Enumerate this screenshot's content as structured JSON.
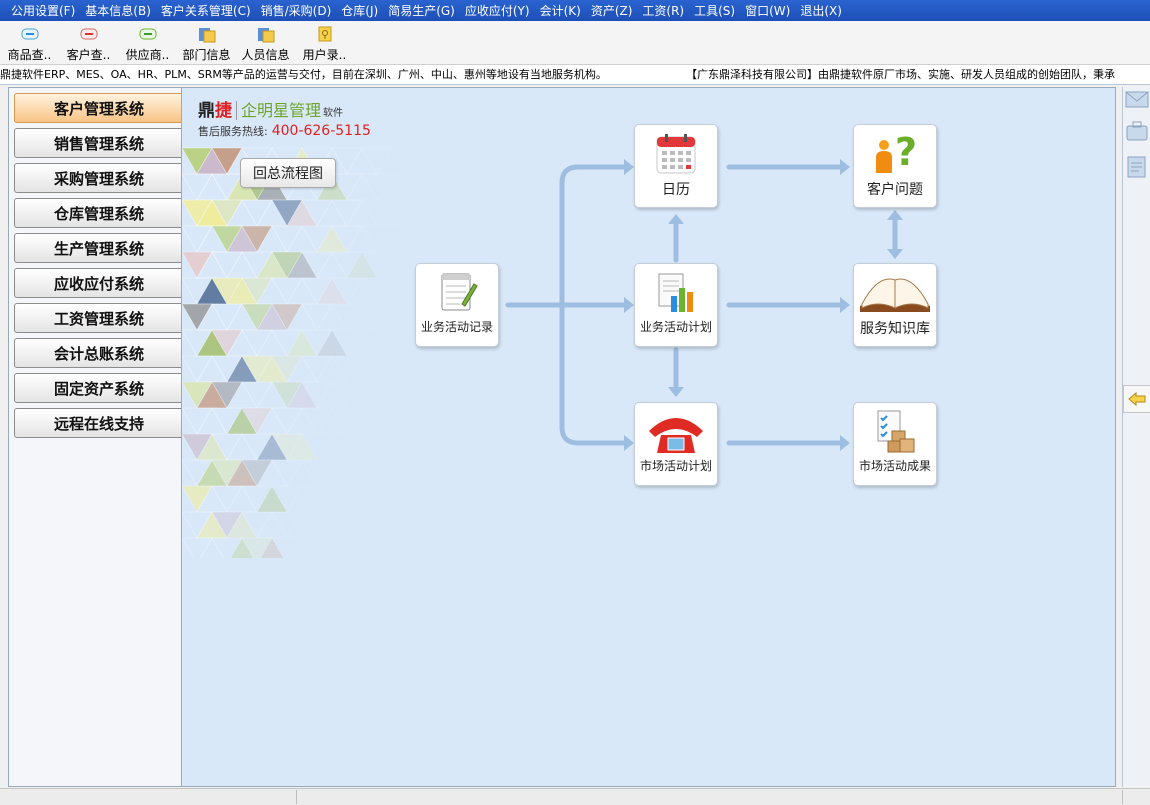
{
  "menu": [
    "公用设置(F)",
    "基本信息(B)",
    "客户关系管理(C)",
    "销售/采购(D)",
    "仓库(J)",
    "简易生产(G)",
    "应收应付(Y)",
    "会计(K)",
    "资产(Z)",
    "工资(R)",
    "工具(S)",
    "窗口(W)",
    "退出(X)"
  ],
  "toolbar": [
    {
      "label": "商品查..",
      "icon": "product-query-icon"
    },
    {
      "label": "客户查..",
      "icon": "customer-query-icon"
    },
    {
      "label": "供应商..",
      "icon": "supplier-icon"
    },
    {
      "label": "部门信息",
      "icon": "department-icon"
    },
    {
      "label": "人员信息",
      "icon": "staff-icon"
    },
    {
      "label": "用户录..",
      "icon": "user-entry-icon"
    }
  ],
  "ticker": {
    "left": "鼎捷软件ERP、MES、OA、HR、PLM、SRM等产品的运营与交付，目前在深圳、广州、中山、惠州等地设有当地服务机构。",
    "right": "【广东鼎泽科技有限公司】由鼎捷软件原厂市场、实施、研发人员组成的创始团队，秉承"
  },
  "nav": [
    "客户管理系统",
    "销售管理系统",
    "采购管理系统",
    "仓库管理系统",
    "生产管理系统",
    "应收应付系统",
    "工资管理系统",
    "会计总账系统",
    "固定资产系统",
    "远程在线支持"
  ],
  "nav_active": 0,
  "brand": {
    "name1": "鼎",
    "name2": "捷",
    "product": "企明星管理",
    "suffix": "软件",
    "hotline_label": "售后服务热线:",
    "hotline": "400-626-5115"
  },
  "back_button": "回总流程图",
  "nodes": {
    "record": "业务活动记录",
    "calendar": "日历",
    "customer_issue": "客户问题",
    "plan": "业务活动计划",
    "knowledge": "服务知识库",
    "market_plan": "市场活动计划",
    "market_result": "市场活动成果"
  },
  "colors": {
    "menubar": "#1d4fb6",
    "main_bg": "#d9e8f9",
    "arrow": "#9dbee0",
    "active_nav": "#f8c487"
  }
}
